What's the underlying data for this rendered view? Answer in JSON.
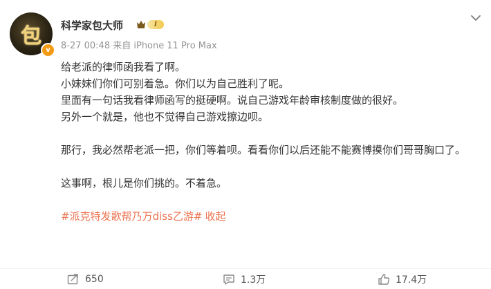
{
  "user": {
    "name": "科学家包大师",
    "level": "I",
    "avatar_text": "包",
    "verified_badge": "v"
  },
  "post": {
    "meta": "8-27 00:48  来自 iPhone 11 Pro Max",
    "lines": [
      "给老派的律师函我看了啊。",
      "小妹妹们你们可别着急。你们以为自己胜利了呢。",
      "里面有一句话我看律师函写的挺硬啊。说自己游戏年龄审核制度做的很好。",
      "另外一个就是，他也不觉得自己游戏擦边呗。",
      "那行，我必然帮老派一把，你们等着呗。看看你们以后还能不能赛博摸你们哥哥胸口了。",
      "这事啊，根儿是你们挑的。不着急。"
    ],
    "hashtag": "#派克特发歌帮乃万diss乙游#",
    "collapse_label": "收起"
  },
  "actions": {
    "share_count": "650",
    "comment_count": "1.3万",
    "like_count": "17.4万"
  },
  "colors": {
    "link": "#eb7350",
    "meta": "#939393",
    "text": "#333333"
  },
  "icons": [
    "more-chevron-icon",
    "member-crown-icon",
    "share-icon",
    "comment-icon",
    "like-icon"
  ]
}
